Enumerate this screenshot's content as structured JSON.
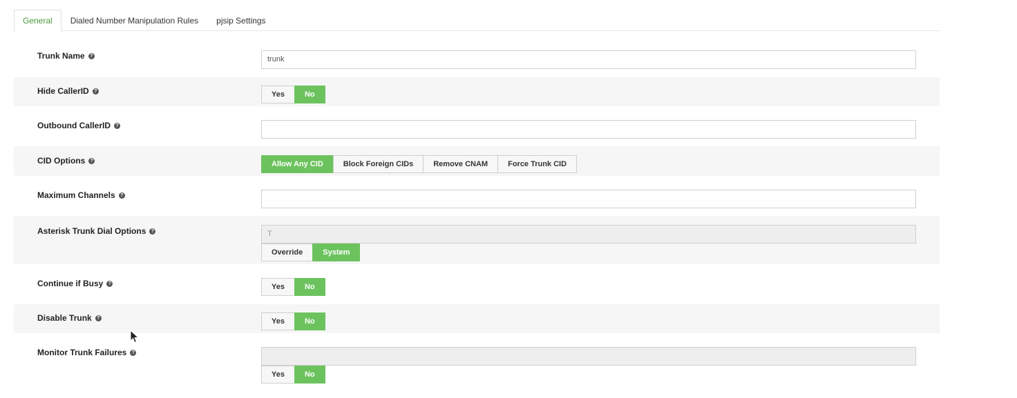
{
  "tabs": [
    {
      "label": "General",
      "active": true
    },
    {
      "label": "Dialed Number Manipulation Rules",
      "active": false
    },
    {
      "label": "pjsip Settings",
      "active": false
    }
  ],
  "help_glyph": "?",
  "fields": {
    "trunk_name": {
      "label": "Trunk Name",
      "value": "trunk"
    },
    "hide_callerid": {
      "label": "Hide CallerID",
      "options": [
        "Yes",
        "No"
      ],
      "selected": "No"
    },
    "outbound_callerid": {
      "label": "Outbound CallerID",
      "value": ""
    },
    "cid_options": {
      "label": "CID Options",
      "options": [
        "Allow Any CID",
        "Block Foreign CIDs",
        "Remove CNAM",
        "Force Trunk CID"
      ],
      "selected": "Allow Any CID"
    },
    "maximum_channels": {
      "label": "Maximum Channels",
      "value": ""
    },
    "dial_options": {
      "label": "Asterisk Trunk Dial Options",
      "value": "T",
      "options": [
        "Override",
        "System"
      ],
      "selected": "System"
    },
    "continue_if_busy": {
      "label": "Continue if Busy",
      "options": [
        "Yes",
        "No"
      ],
      "selected": "No"
    },
    "disable_trunk": {
      "label": "Disable Trunk",
      "options": [
        "Yes",
        "No"
      ],
      "selected": "No"
    },
    "monitor_trunk_failures": {
      "label": "Monitor Trunk Failures",
      "value": "",
      "options": [
        "Yes",
        "No"
      ],
      "selected": "No"
    }
  },
  "colors": {
    "accent": "#6cc35e",
    "tab_active_text": "#4a9b3b",
    "row_shade": "#f6f6f6"
  }
}
